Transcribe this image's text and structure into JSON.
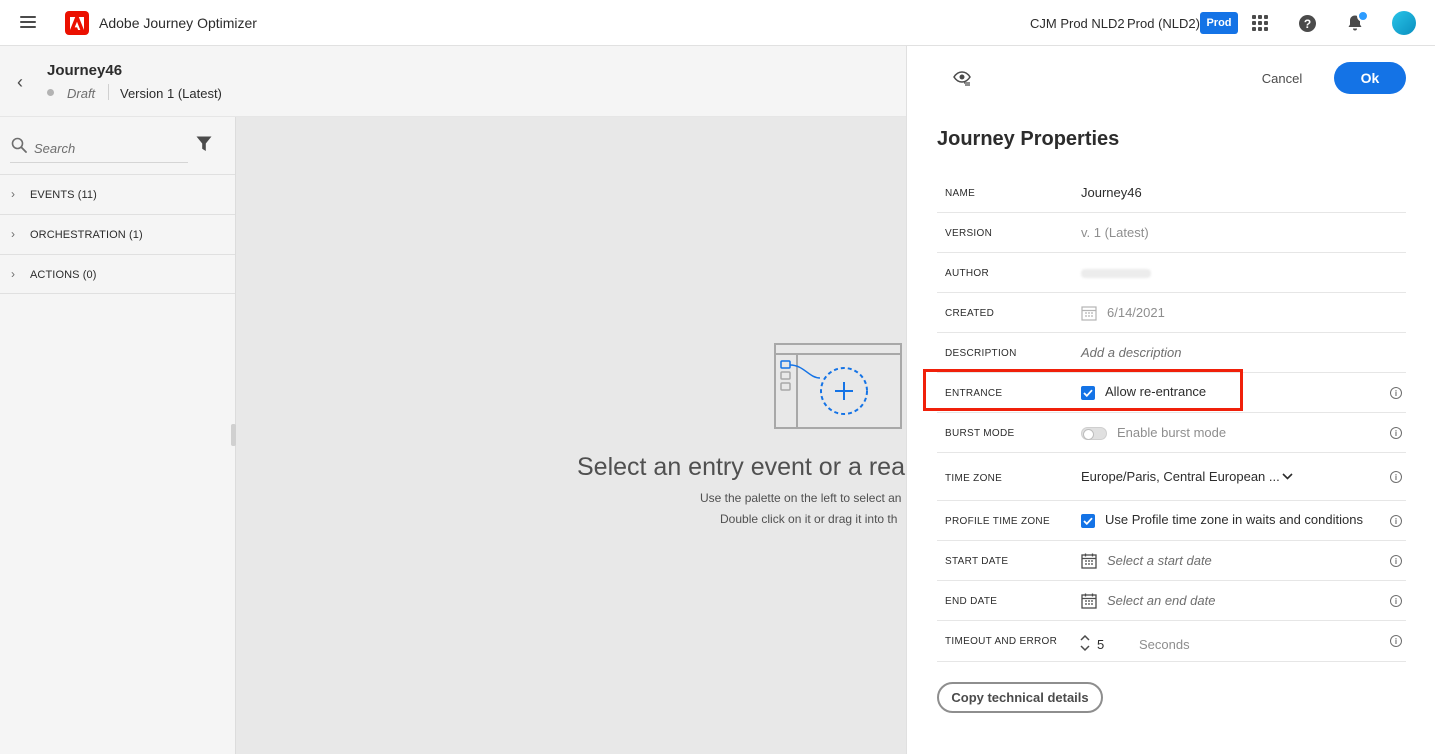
{
  "topbar": {
    "app_title": "Adobe Journey Optimizer",
    "org_name": "CJM Prod NLD2",
    "sandbox": "Prod (NLD2)",
    "env_badge": "Prod",
    "help_glyph": "?"
  },
  "journey": {
    "name": "Journey46",
    "status": "Draft",
    "version": "Version 1 (Latest)"
  },
  "palette": {
    "search_placeholder": "Search",
    "sections": [
      {
        "label": "EVENTS (11)"
      },
      {
        "label": "ORCHESTRATION (1)"
      },
      {
        "label": "ACTIONS (0)"
      }
    ]
  },
  "canvas": {
    "title": "Select an entry event or a reac",
    "hint_line1": "Use the palette on the left to select an",
    "hint_line2": "Double click on it or drag it into th"
  },
  "properties": {
    "cancel_label": "Cancel",
    "ok_label": "Ok",
    "title": "Journey Properties",
    "rows": {
      "name": {
        "label": "NAME",
        "value": "Journey46"
      },
      "version": {
        "label": "VERSION",
        "value": "v. 1 (Latest)"
      },
      "author": {
        "label": "AUTHOR",
        "value": ""
      },
      "created": {
        "label": "CREATED",
        "value": "6/14/2021"
      },
      "description": {
        "label": "DESCRIPTION",
        "placeholder": "Add a description"
      },
      "entrance": {
        "label": "ENTRANCE",
        "checkbox_label": "Allow re-entrance",
        "checked": true
      },
      "burst_mode": {
        "label": "BURST MODE",
        "toggle_label": "Enable burst mode",
        "on": false
      },
      "time_zone": {
        "label": "TIME ZONE",
        "value": "Europe/Paris, Central European ..."
      },
      "profile_time_zone": {
        "label": "PROFILE TIME ZONE",
        "checkbox_label": "Use Profile time zone in waits and conditions",
        "checked": true
      },
      "start_date": {
        "label": "START DATE",
        "placeholder": "Select a start date"
      },
      "end_date": {
        "label": "END DATE",
        "placeholder": "Select an end date"
      },
      "timeout": {
        "label": "TIMEOUT AND ERROR",
        "value": "5",
        "unit": "Seconds"
      }
    },
    "copy_button": "Copy technical details",
    "info_glyph": "i"
  },
  "colors": {
    "accent": "#1473e6",
    "highlight": "#f0200a",
    "brand_red": "#eb1000"
  }
}
